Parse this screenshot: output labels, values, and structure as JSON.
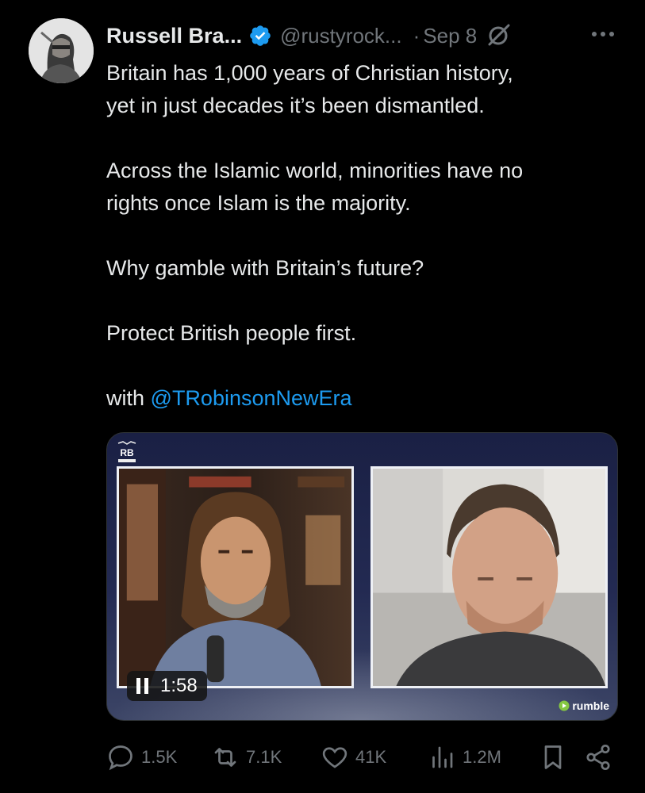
{
  "author": {
    "name": "Russell Bra...",
    "handle": "@rustyrock...",
    "separator": "·",
    "date": "Sep 8",
    "verified": true
  },
  "tweet": {
    "line1": "Britain has 1,000 years of Christian history,",
    "line2": "yet in just decades it’s been dismantled.",
    "line3": "Across the Islamic world, minorities have no",
    "line4": "rights once Islam is the majority.",
    "line5": "Why gamble with Britain’s future?",
    "line6": "Protect British people first.",
    "with_prefix": "with ",
    "mention": "@TRobinsonNewEra"
  },
  "media": {
    "type": "video",
    "duration": "1:58",
    "state": "playing",
    "provider": "rumble",
    "logo_text": "RB"
  },
  "actions": {
    "replies": "1.5K",
    "reposts": "7.1K",
    "likes": "41K",
    "views": "1.2M"
  },
  "colors": {
    "background": "#000000",
    "text": "#e7e9ea",
    "muted": "#71767b",
    "link": "#1d9bf0",
    "verified": "#1d9bf0"
  },
  "icons": [
    "verified-badge-icon",
    "grok-icon",
    "more-icon",
    "pause-icon",
    "rumble-icon",
    "reply-icon",
    "repost-icon",
    "like-icon",
    "views-icon",
    "bookmark-icon",
    "share-icon"
  ]
}
